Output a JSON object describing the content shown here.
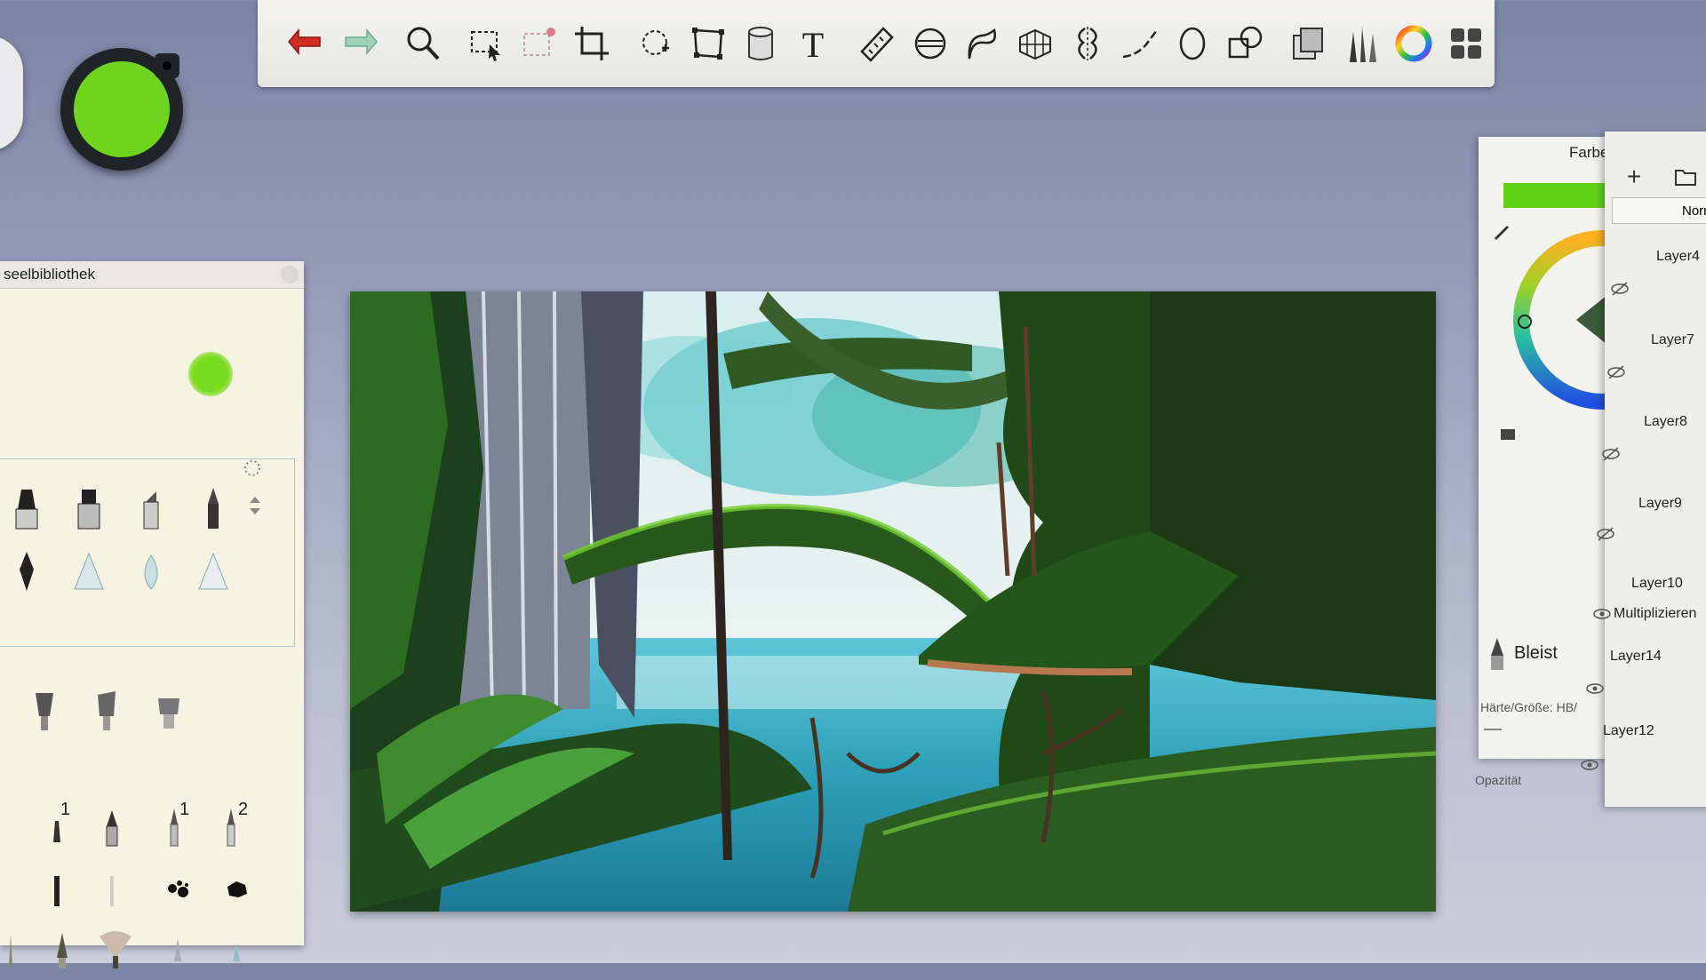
{
  "toolbar": {
    "tools": [
      {
        "name": "undo-icon"
      },
      {
        "name": "redo-icon"
      },
      {
        "name": "zoom-icon"
      },
      {
        "name": "select-icon"
      },
      {
        "name": "magic-select-icon"
      },
      {
        "name": "crop-icon"
      },
      {
        "name": "transform-icon"
      },
      {
        "name": "distort-icon"
      },
      {
        "name": "fill-bucket-icon"
      },
      {
        "name": "text-icon"
      },
      {
        "name": "ruler-icon"
      },
      {
        "name": "ellipse-guide-icon"
      },
      {
        "name": "french-curve-icon"
      },
      {
        "name": "perspective-icon"
      },
      {
        "name": "symmetry-icon"
      },
      {
        "name": "stroke-icon"
      },
      {
        "name": "ellipse-icon"
      },
      {
        "name": "shapes-icon"
      },
      {
        "name": "layers-copy-icon"
      },
      {
        "name": "brushes-icon"
      },
      {
        "name": "color-wheel-icon"
      },
      {
        "name": "grid-icon"
      }
    ],
    "text_tool_glyph": "T"
  },
  "color_puck": {
    "color": "#6ed41d"
  },
  "brush_library": {
    "title": "seelbibliothek",
    "row_numbers": [
      "1",
      "1",
      "2"
    ]
  },
  "color_panel": {
    "title": "Farbe",
    "current_color": "#5fd218",
    "brush_name": "Bleist",
    "hardness_label": "Härte/Größe: HB/",
    "opacity_label": "Opazität"
  },
  "layer_panel": {
    "blend_mode": "Norm",
    "blend_label": "Multiplizieren",
    "layers": [
      {
        "label": "Layer4",
        "visible": false
      },
      {
        "label": "Layer7",
        "visible": false
      },
      {
        "label": "Layer8",
        "visible": false
      },
      {
        "label": "Layer9",
        "visible": false
      },
      {
        "label": "Layer10",
        "visible": true
      },
      {
        "label": "Layer14",
        "visible": true
      },
      {
        "label": "Layer12",
        "visible": true
      }
    ]
  }
}
